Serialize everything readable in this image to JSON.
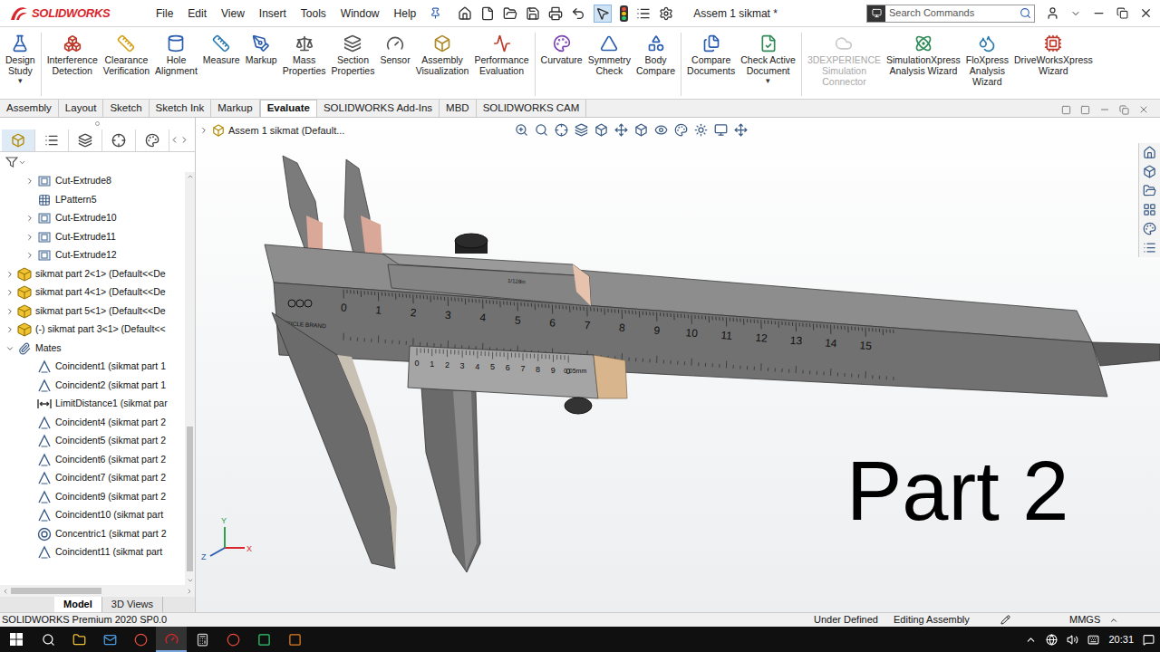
{
  "app": {
    "logo": "SOLIDWORKS",
    "title": "Assem 1 sikmat *",
    "search_placeholder": "Search Commands"
  },
  "menu": [
    "File",
    "Edit",
    "View",
    "Insert",
    "Tools",
    "Window",
    "Help"
  ],
  "ribbon": [
    [
      {
        "lines": [
          "Design",
          "Study"
        ],
        "dropdown": "▾",
        "disabled": false
      }
    ],
    [
      {
        "lines": [
          "Interference",
          "Detection"
        ],
        "dropdown": "",
        "disabled": false
      },
      {
        "lines": [
          "Clearance",
          "Verification"
        ],
        "dropdown": "",
        "disabled": false
      },
      {
        "lines": [
          "Hole",
          "Alignment"
        ],
        "dropdown": "",
        "disabled": false
      },
      {
        "lines": [
          "Measure"
        ],
        "dropdown": "",
        "disabled": false
      },
      {
        "lines": [
          "Markup"
        ],
        "dropdown": "",
        "disabled": false
      },
      {
        "lines": [
          "Mass",
          "Properties"
        ],
        "dropdown": "",
        "disabled": false
      },
      {
        "lines": [
          "Section",
          "Properties"
        ],
        "dropdown": "",
        "disabled": false
      },
      {
        "lines": [
          "Sensor"
        ],
        "dropdown": "",
        "disabled": false
      },
      {
        "lines": [
          "Assembly",
          "Visualization"
        ],
        "dropdown": "",
        "disabled": false
      },
      {
        "lines": [
          "Performance",
          "Evaluation"
        ],
        "dropdown": "",
        "disabled": false
      }
    ],
    [
      {
        "lines": [
          "Curvature"
        ],
        "dropdown": "",
        "disabled": false
      },
      {
        "lines": [
          "Symmetry",
          "Check"
        ],
        "dropdown": "",
        "disabled": false
      },
      {
        "lines": [
          "Body",
          "Compare"
        ],
        "dropdown": "",
        "disabled": false
      }
    ],
    [
      {
        "lines": [
          "Compare",
          "Documents"
        ],
        "dropdown": "",
        "disabled": false
      },
      {
        "lines": [
          "Check Active",
          "Document"
        ],
        "dropdown": "▾",
        "disabled": false
      }
    ],
    [
      {
        "lines": [
          "3DEXPERIENCE",
          "Simulation",
          "Connector"
        ],
        "dropdown": "",
        "disabled": true
      },
      {
        "lines": [
          "SimulationXpress",
          "Analysis Wizard"
        ],
        "dropdown": "",
        "disabled": false
      },
      {
        "lines": [
          "FloXpress",
          "Analysis",
          "Wizard"
        ],
        "dropdown": "",
        "disabled": false
      },
      {
        "lines": [
          "DriveWorksXpress",
          "Wizard"
        ],
        "dropdown": "",
        "disabled": false
      }
    ]
  ],
  "tabs": [
    {
      "label": "Assembly",
      "selected": false
    },
    {
      "label": "Layout",
      "selected": false
    },
    {
      "label": "Sketch",
      "selected": false
    },
    {
      "label": "Sketch Ink",
      "selected": false
    },
    {
      "label": "Markup",
      "selected": false
    },
    {
      "label": "Evaluate",
      "selected": true
    },
    {
      "label": "SOLIDWORKS Add-Ins",
      "selected": false
    },
    {
      "label": "MBD",
      "selected": false
    },
    {
      "label": "SOLIDWORKS CAM",
      "selected": false
    }
  ],
  "tree": {
    "items": [
      {
        "label": "Cut-Extrude8",
        "kind": "feature",
        "expandable": true,
        "expanded": false
      },
      {
        "label": "LPattern5",
        "kind": "pattern",
        "expandable": false,
        "expanded": false
      },
      {
        "label": "Cut-Extrude10",
        "kind": "feature",
        "expandable": true,
        "expanded": false
      },
      {
        "label": "Cut-Extrude11",
        "kind": "feature",
        "expandable": true,
        "expanded": false
      },
      {
        "label": "Cut-Extrude12",
        "kind": "feature",
        "expandable": true,
        "expanded": false
      },
      {
        "label": "sikmat part 2<1> (Default<<De",
        "kind": "part",
        "expandable": true,
        "expanded": false
      },
      {
        "label": "sikmat part 4<1> (Default<<De",
        "kind": "part",
        "expandable": true,
        "expanded": false
      },
      {
        "label": "sikmat part 5<1> (Default<<De",
        "kind": "part",
        "expandable": true,
        "expanded": false
      },
      {
        "label": "(-) sikmat part 3<1> (Default<<",
        "kind": "part",
        "expandable": true,
        "expanded": false
      },
      {
        "label": "Mates",
        "kind": "mates",
        "expandable": true,
        "expanded": true
      },
      {
        "label": "Coincident1 (sikmat part 1",
        "kind": "coincident",
        "expandable": false,
        "expanded": false
      },
      {
        "label": "Coincident2 (sikmat part 1",
        "kind": "coincident",
        "expandable": false,
        "expanded": false
      },
      {
        "label": "LimitDistance1 (sikmat par",
        "kind": "limit-distance",
        "expandable": false,
        "expanded": false
      },
      {
        "label": "Coincident4 (sikmat part 2",
        "kind": "coincident",
        "expandable": false,
        "expanded": false
      },
      {
        "label": "Coincident5 (sikmat part 2",
        "kind": "coincident",
        "expandable": false,
        "expanded": false
      },
      {
        "label": "Coincident6 (sikmat part 2",
        "kind": "coincident",
        "expandable": false,
        "expanded": false
      },
      {
        "label": "Coincident7 (sikmat part 2",
        "kind": "coincident",
        "expandable": false,
        "expanded": false
      },
      {
        "label": "Coincident9 (sikmat part 2",
        "kind": "coincident",
        "expandable": false,
        "expanded": false
      },
      {
        "label": "Coincident10 (sikmat part",
        "kind": "coincident",
        "expandable": false,
        "expanded": false
      },
      {
        "label": "Concentric1 (sikmat part 2",
        "kind": "concentric",
        "expandable": false,
        "expanded": false
      },
      {
        "label": "Coincident11 (sikmat part",
        "kind": "coincident",
        "expandable": false,
        "expanded": false
      }
    ]
  },
  "bottom_tabs": [
    {
      "label": "Model",
      "selected": true
    },
    {
      "label": "3D Views",
      "selected": false
    }
  ],
  "viewport": {
    "breadcrumb": "Assem 1 sikmat  (Default...",
    "overlay": "Part 2",
    "axes": {
      "x": "X",
      "y": "Y",
      "z": "Z"
    },
    "caliper": {
      "brand": "TRICLE BRAND",
      "main_scale": [
        "0",
        "1",
        "2",
        "3",
        "4",
        "5",
        "6",
        "7",
        "8",
        "9",
        "10",
        "11",
        "12",
        "13",
        "14",
        "15"
      ],
      "vernier_scale": [
        "0",
        "1",
        "2",
        "3",
        "4",
        "5",
        "6",
        "7",
        "8",
        "9",
        "0"
      ],
      "vernier_unit": "0.05mm",
      "depth_unit": "1/128in"
    }
  },
  "status_bar": {
    "product": "SOLIDWORKS Premium 2020 SP0.0",
    "state": "Under Defined",
    "mode": "Editing Assembly",
    "units": "MMGS"
  },
  "taskbar": {
    "time": "20:31"
  }
}
